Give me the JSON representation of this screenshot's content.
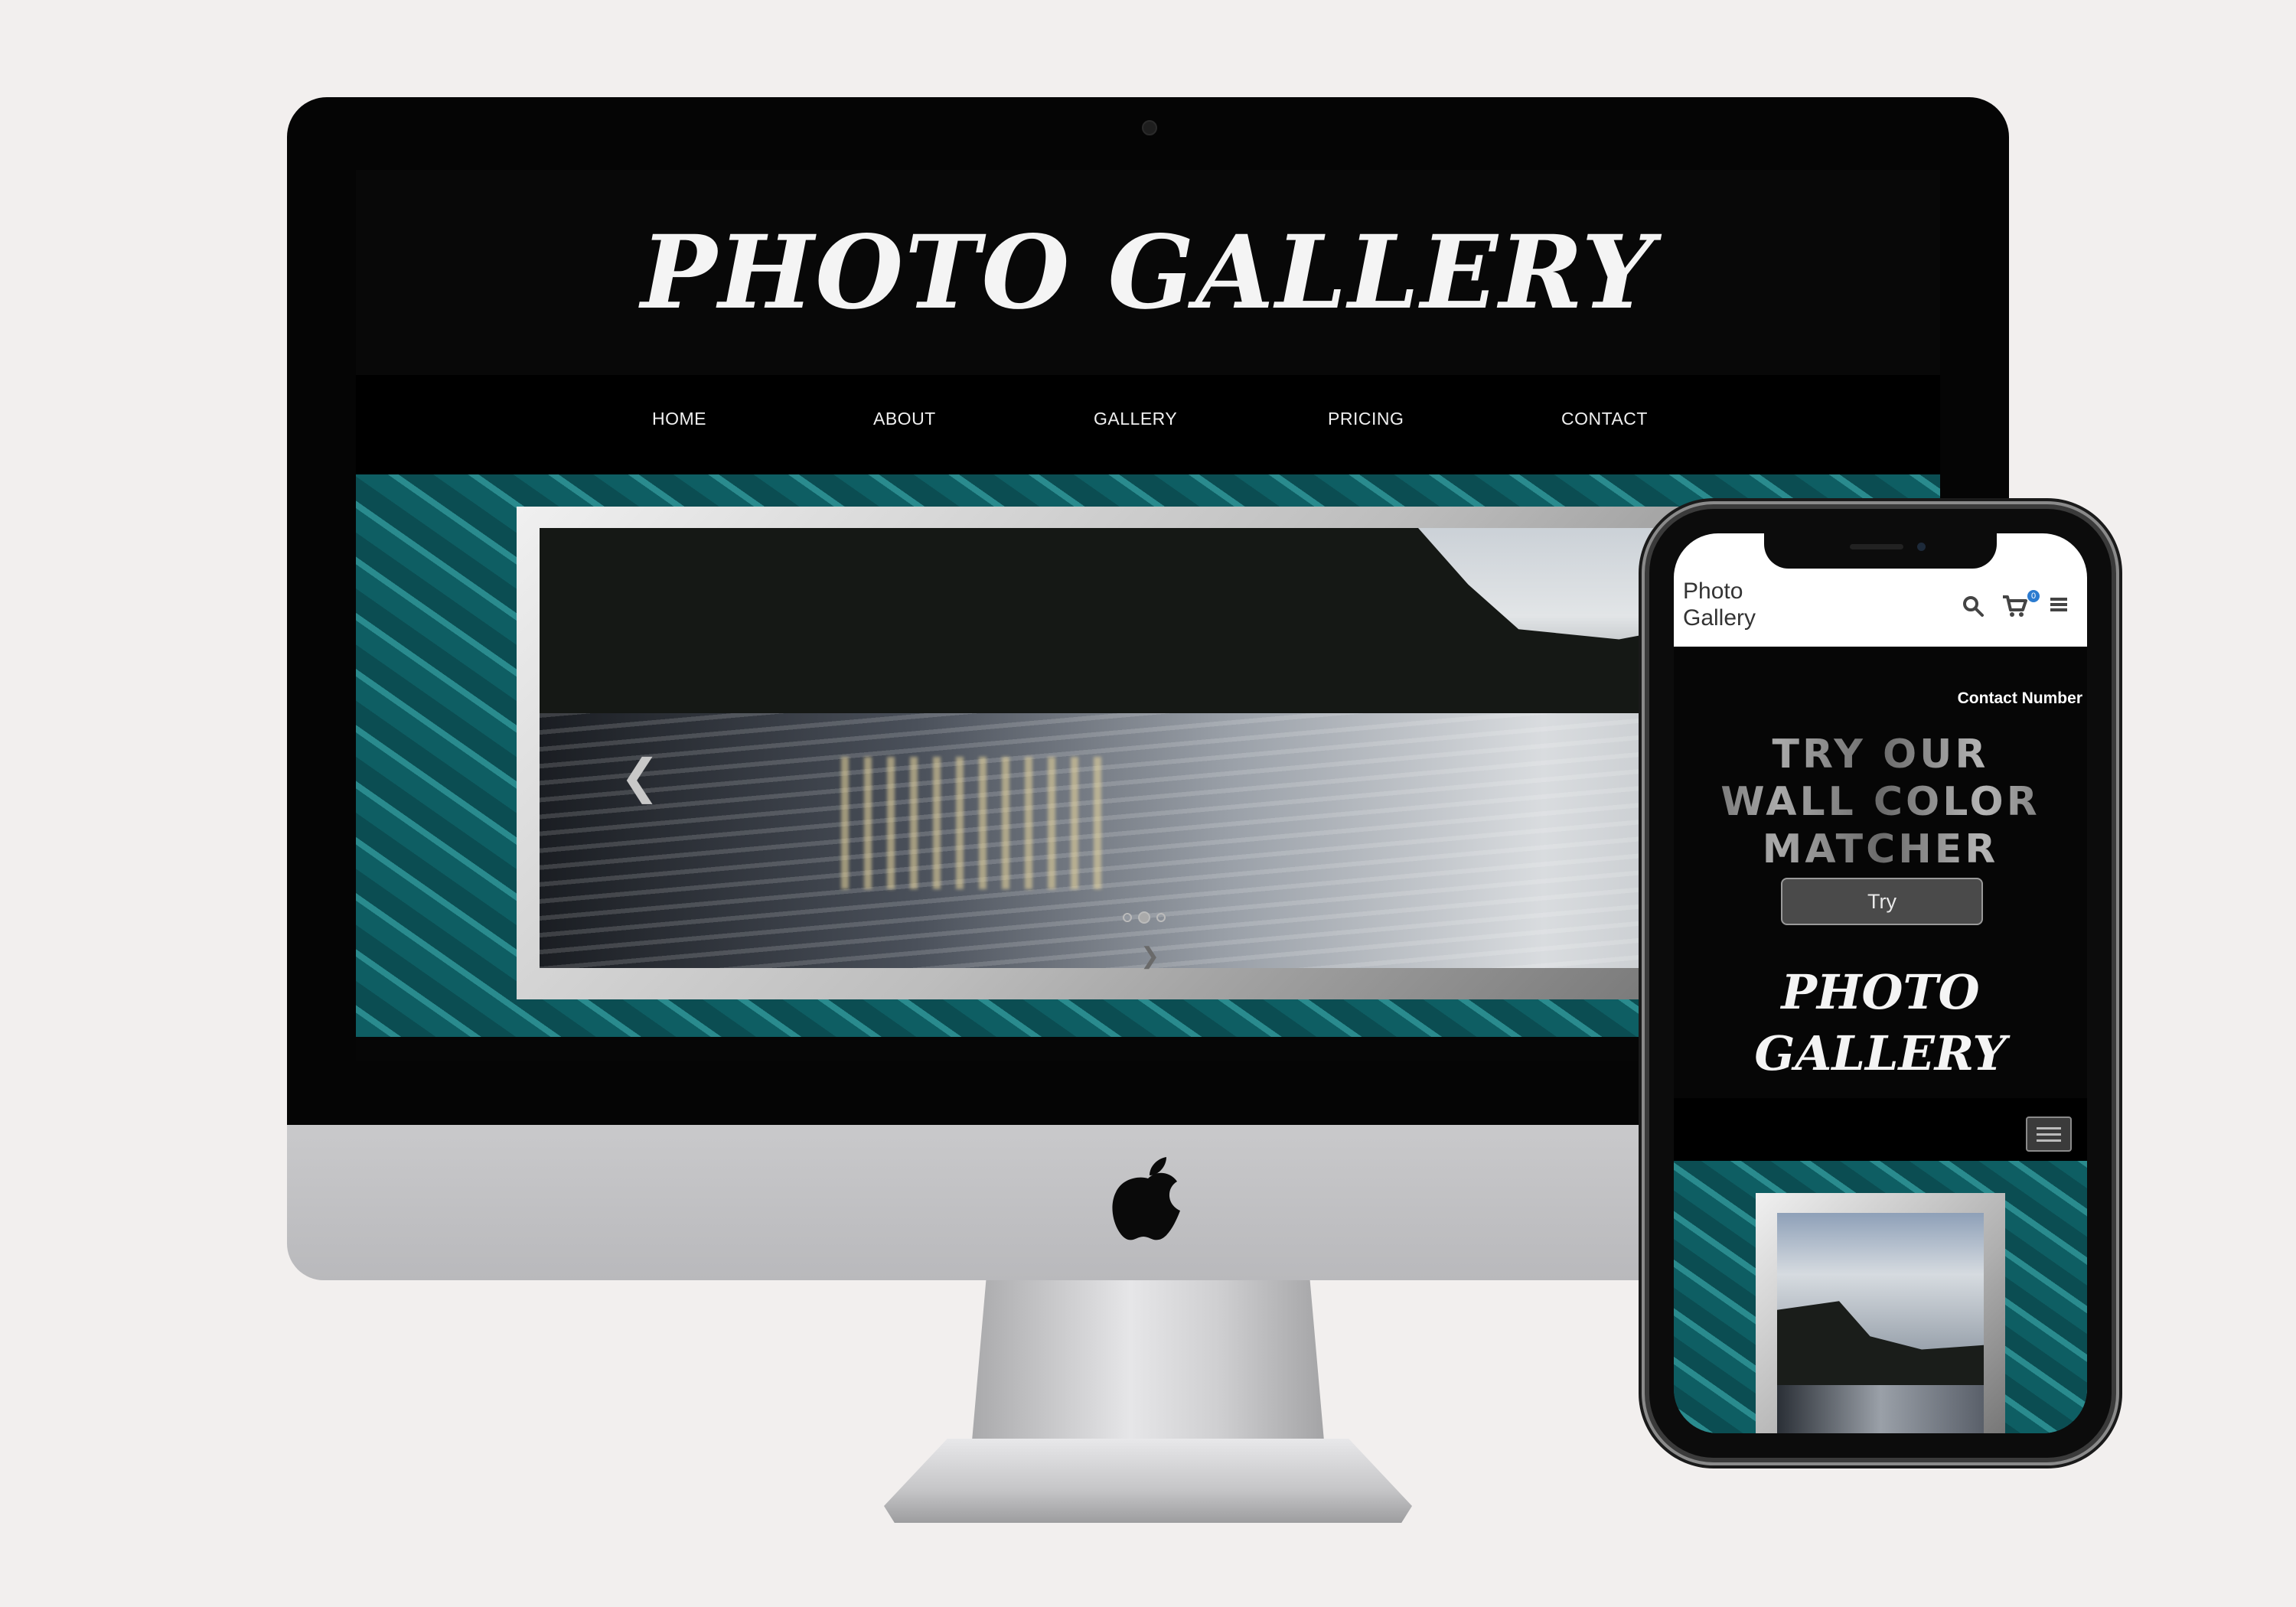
{
  "desktop": {
    "site_title": "PHOTO GALLERY",
    "nav": [
      "HOME",
      "ABOUT",
      "GALLERY",
      "PRICING",
      "CONTACT"
    ],
    "carousel": {
      "prev_icon": "chevron-left-icon",
      "next_icon": "chevron-right-icon",
      "slide_count": 3,
      "active_slide": 2
    }
  },
  "mobile": {
    "logo": [
      "Photo",
      "Gallery"
    ],
    "icons": [
      "search-icon",
      "cart-icon",
      "menu-icon"
    ],
    "cart_count": "0",
    "contact": "Contact Number",
    "promo": [
      "TRY OUR",
      "WALL COLOR",
      "MATCHER"
    ],
    "try_label": "Try",
    "site_title": [
      "PHOTO",
      "GALLERY"
    ]
  },
  "colors": {
    "background": "#f2efee",
    "screen": "#060606",
    "pool_teal": "#1b7479",
    "cart_badge": "#2b7bd0"
  }
}
